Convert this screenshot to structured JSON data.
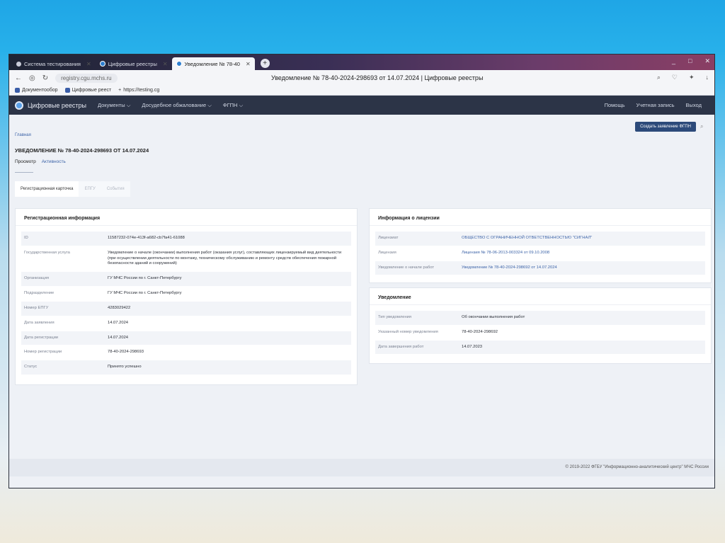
{
  "browser": {
    "tabs": [
      {
        "label": "Система тестирования "
      },
      {
        "label": "Цифровые реестры"
      },
      {
        "label": "Уведомление № 78-40"
      }
    ],
    "new_tab": "+",
    "window_controls": {
      "minimize": "_",
      "maximize": "□",
      "close": "✕"
    },
    "address": {
      "url": "registry.cgu.mchs.ru",
      "page_title": "Уведомление № 78-40-2024-298693 от 14.07.2024 | Цифровые реестры"
    },
    "bookmarks": [
      {
        "label": "Документообор"
      },
      {
        "label": "Цифровые реест"
      },
      {
        "label": "https://testing.cg"
      }
    ]
  },
  "appnav": {
    "brand": "Цифровые реестры",
    "menu": [
      "Документы",
      "Досудебное обжалование",
      "ФГПН"
    ],
    "right": [
      "Помощь",
      "Учетная запись",
      "Выход"
    ]
  },
  "page": {
    "breadcrumb": "Главная",
    "title": "УВЕДОМЛЕНИЕ № 78-40-2024-298693 ОТ 14.07.2024",
    "create_button": "Создать заявление ФГПН",
    "view_tabs": [
      "Просмотр",
      "Активность"
    ],
    "card_tabs": [
      "Регистрационная карточка",
      "ЕПГУ",
      "События"
    ]
  },
  "reg_info": {
    "title": "Регистрационная информация",
    "rows": [
      {
        "k": "ID",
        "v": "11587232-074e-413f-a682-cb7fa41-61088"
      },
      {
        "k": "Государственная услуга",
        "v": "Уведомление о начале (окончании) выполнения работ (оказания услуг), составляющих лицензируемый вид деятельности (при осуществлении деятельности по монтажу, техническому обслуживанию и ремонту средств обеспечения пожарной безопасности зданий и сооружений)"
      },
      {
        "k": "Организация",
        "v": "ГУ МЧС России по г. Санкт-Петербургу"
      },
      {
        "k": "Подразделение",
        "v": "ГУ МЧС России по г. Санкт-Петербургу"
      },
      {
        "k": "Номер ЕПГУ",
        "v": "4283029422"
      },
      {
        "k": "Дата заявления",
        "v": "14.07.2024"
      },
      {
        "k": "Дата регистрации",
        "v": "14.07.2024"
      },
      {
        "k": "Номер регистрации",
        "v": "78-40-2024-298693"
      },
      {
        "k": "Статус",
        "v": "Принято успешно"
      }
    ]
  },
  "license_info": {
    "title": "Информация о лицензии",
    "rows": [
      {
        "k": "Лицензиат",
        "v": "ОБЩЕСТВО С ОГРАНИЧЕННОЙ ОТВЕТСТВЕННОСТЬЮ \"СИГНАЛ\""
      },
      {
        "k": "Лицензия",
        "v": "Лицензия № 78-06-2013-003324 от 09.10.2008"
      },
      {
        "k": "Уведомление о начале работ",
        "v": "Уведомление № 78-40-2024-298692 от 14.07.2024"
      }
    ]
  },
  "notification": {
    "title": "Уведомление",
    "rows": [
      {
        "k": "Тип уведомления",
        "v": "Об окончании выполнения работ"
      },
      {
        "k": "Указанный номер уведомления",
        "v": "78-40-2024-298692"
      },
      {
        "k": "Дата завершения работ",
        "v": "14.07.2023"
      }
    ]
  },
  "footer": "© 2019-2022 ФГБУ \"Информационно-аналитический центр\" МЧС России"
}
